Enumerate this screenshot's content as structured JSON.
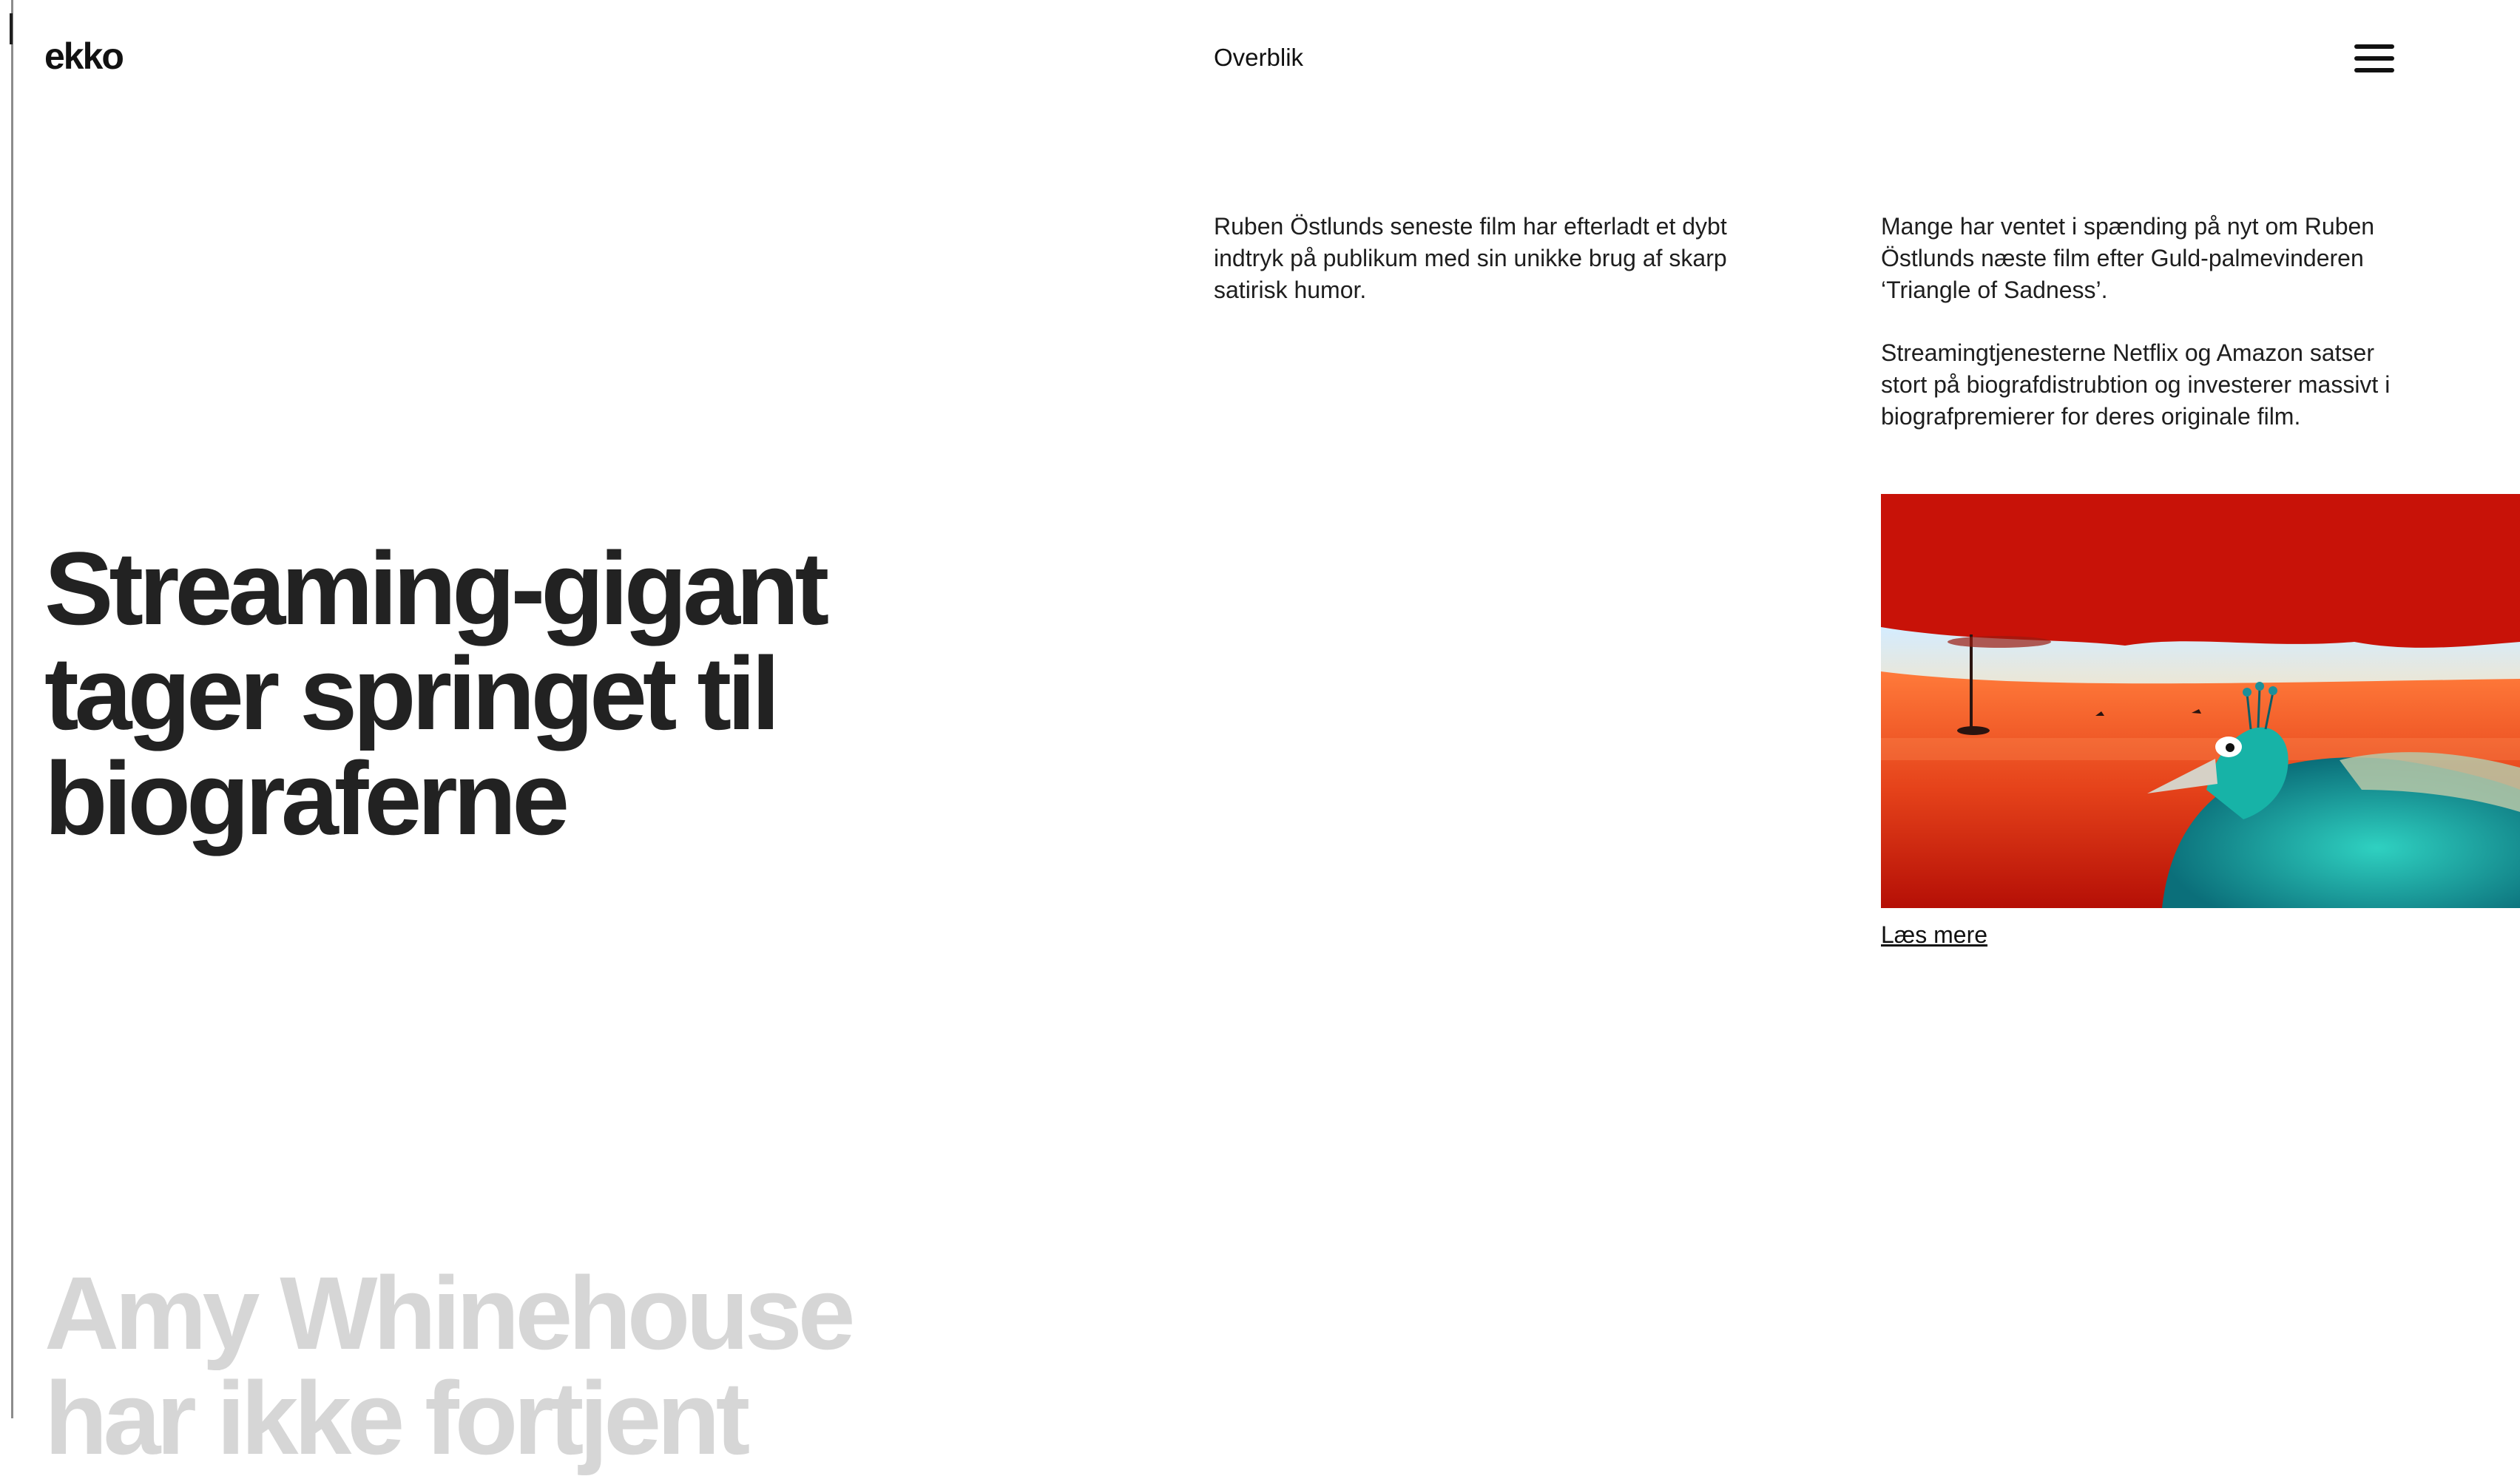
{
  "header": {
    "logo": "ekko",
    "nav_label": "Overblik",
    "menu_icon": "hamburger-menu-icon"
  },
  "articles": {
    "teaser_1": "Ruben Östlunds seneste film har efterladt et dybt indtryk på publikum med sin unikke brug af skarp satirisk humor.",
    "teaser_2": "Mange har ventet i spænding på nyt om Ruben Östlunds næste film efter Guld-palmevinderen ‘Triangle of Sadness’.",
    "teaser_3": "Streamingtjenesterne Netflix og Amazon satser stort på biografdistrubtion og investerer massivt i biografpremierer for deres originale film.",
    "read_more": "Læs mere"
  },
  "hero": {
    "headline": "Streaming-gigant tager springet til biograferne",
    "next_headline": "Amy Whinehouse har ikke fortjent"
  },
  "colors": {
    "text": "#1e1e1e",
    "faded_headline": "#d6d6d6",
    "image_red": "#c81208",
    "image_teal": "#1fa7a0"
  }
}
